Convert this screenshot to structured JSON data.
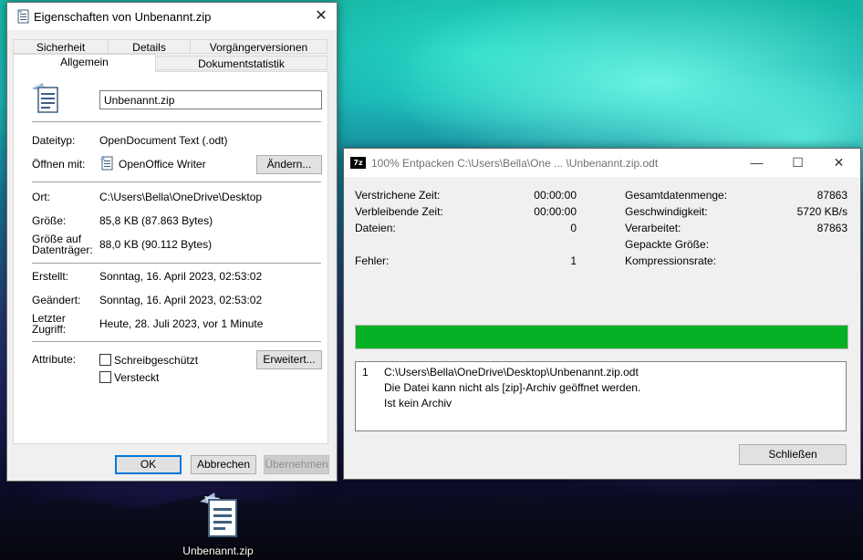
{
  "properties_dialog": {
    "title": "Eigenschaften von Unbenannt.zip",
    "tabs_row1": [
      "Sicherheit",
      "Details",
      "Vorgängerversionen"
    ],
    "tabs_row2": [
      "Allgemein",
      "Dokumentstatistik"
    ],
    "active_tab": "Allgemein",
    "filename": "Unbenannt.zip",
    "filetype_label": "Dateityp:",
    "filetype_value": "OpenDocument Text (.odt)",
    "open_with_label": "Öffnen mit:",
    "open_with_value": "OpenOffice Writer",
    "change_button": "Ändern...",
    "location_label": "Ort:",
    "location_value": "C:\\Users\\Bella\\OneDrive\\Desktop",
    "size_label": "Größe:",
    "size_value": "85,8 KB (87.863 Bytes)",
    "size_on_disk_label_1": "Größe auf",
    "size_on_disk_label_2": "Datenträger:",
    "size_on_disk_value": "88,0 KB (90.112 Bytes)",
    "created_label": "Erstellt:",
    "created_value": "Sonntag, 16. April 2023, 02:53:02",
    "modified_label": "Geändert:",
    "modified_value": "Sonntag, 16. April 2023, 02:53:02",
    "accessed_label_1": "Letzter",
    "accessed_label_2": "Zugriff:",
    "accessed_value": "Heute, 28. Juli 2023, vor 1 Minute",
    "attributes_label": "Attribute:",
    "readonly_label": "Schreibgeschützt",
    "hidden_label": "Versteckt",
    "advanced_button": "Erweitert...",
    "ok_button": "OK",
    "cancel_button": "Abbrechen",
    "apply_button": "Übernehmen"
  },
  "zip_window": {
    "title": "100% Entpacken C:\\Users\\Bella\\One ... \\Unbenannt.zip.odt",
    "logo_text": "7z",
    "left_stats": [
      {
        "label": "Verstrichene Zeit:",
        "value": "00:00:00"
      },
      {
        "label": "Verbleibende Zeit:",
        "value": "00:00:00"
      },
      {
        "label": "Dateien:",
        "value": "0"
      }
    ],
    "errors_label": "Fehler:",
    "errors_value": "1",
    "right_stats": [
      {
        "label": "Gesamtdatenmenge:",
        "value": "87863"
      },
      {
        "label": "Geschwindigkeit:",
        "value": "5720 KB/s"
      },
      {
        "label": "Verarbeitet:",
        "value": "87863"
      },
      {
        "label": "Gepackte Größe:",
        "value": ""
      },
      {
        "label": "Kompressionsrate:",
        "value": ""
      }
    ],
    "progress_percent": 100,
    "progress_color": "#06b025",
    "log": {
      "index": "1",
      "lines": [
        "C:\\Users\\Bella\\OneDrive\\Desktop\\Unbenannt.zip.odt",
        "Die Datei kann nicht als [zip]-Archiv geöffnet werden.",
        "Ist kein Archiv"
      ]
    },
    "close_button": "Schließen"
  },
  "desktop_icon": {
    "label": "Unbenannt.zip"
  }
}
